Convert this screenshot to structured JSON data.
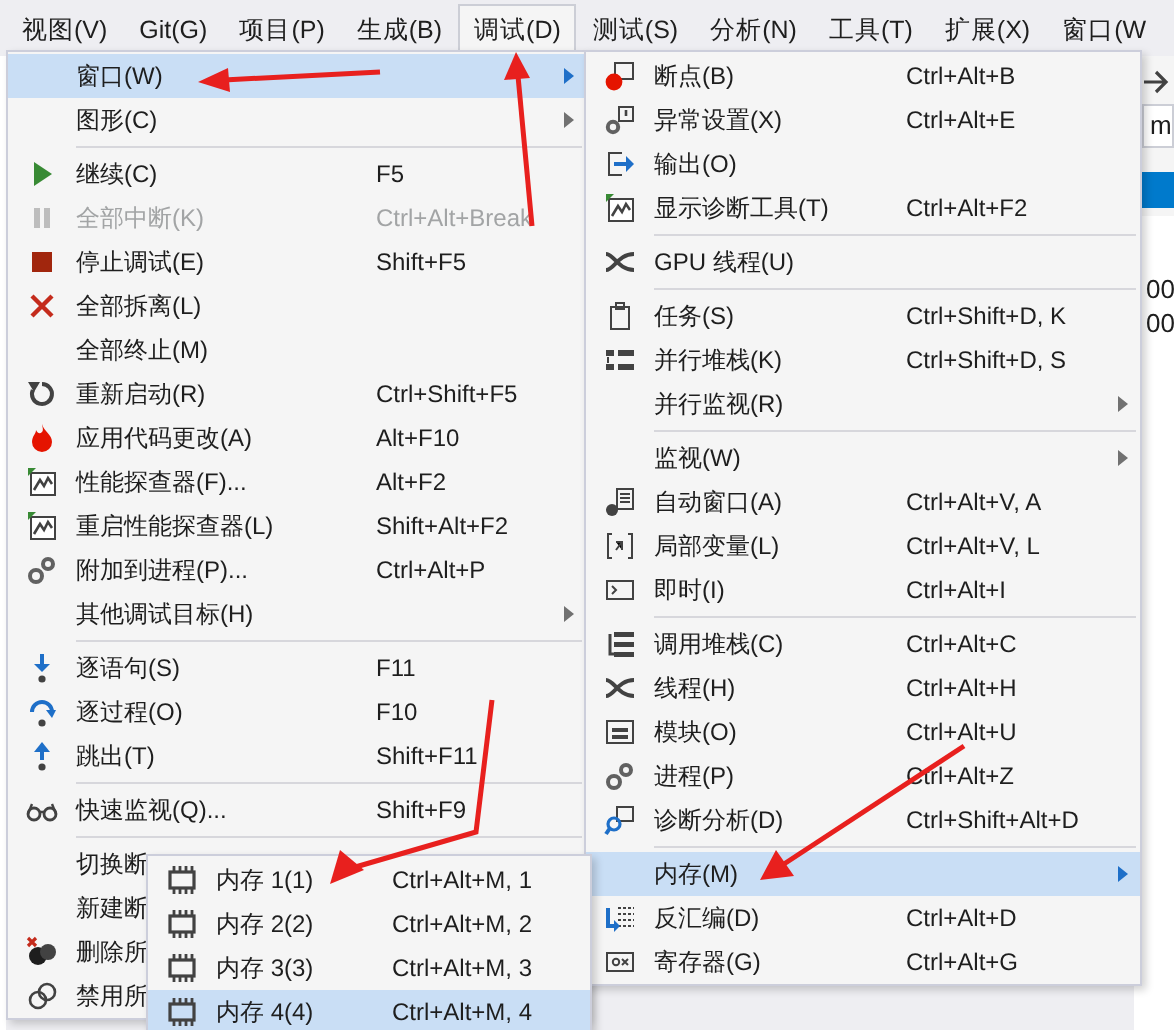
{
  "menu_bar": [
    {
      "label": "视图(V)",
      "selected": false
    },
    {
      "label": "Git(G)",
      "selected": false
    },
    {
      "label": "项目(P)",
      "selected": false
    },
    {
      "label": "生成(B)",
      "selected": false
    },
    {
      "label": "调试(D)",
      "selected": true
    },
    {
      "label": "测试(S)",
      "selected": false
    },
    {
      "label": "分析(N)",
      "selected": false
    },
    {
      "label": "工具(T)",
      "selected": false
    },
    {
      "label": "扩展(X)",
      "selected": false
    },
    {
      "label": "窗口(W",
      "selected": false
    }
  ],
  "background": {
    "field_value": "m",
    "lines": [
      "00",
      "00"
    ]
  },
  "debug_menu": {
    "items": [
      {
        "kind": "item",
        "label": "窗口(W)",
        "submenu": true,
        "disabled": false,
        "selected": true
      },
      {
        "kind": "item",
        "label": "图形(C)",
        "submenu": true,
        "disabled": false,
        "selected": false
      },
      {
        "kind": "separator"
      },
      {
        "kind": "item",
        "label": "继续(C)",
        "shortcut": "F5",
        "submenu": false,
        "disabled": false,
        "selected": false
      },
      {
        "kind": "item",
        "label": "全部中断(K)",
        "shortcut": "Ctrl+Alt+Break",
        "submenu": false,
        "disabled": true,
        "selected": false
      },
      {
        "kind": "item",
        "label": "停止调试(E)",
        "shortcut": "Shift+F5",
        "submenu": false,
        "disabled": false,
        "selected": false
      },
      {
        "kind": "item",
        "label": "全部拆离(L)",
        "submenu": false,
        "disabled": false,
        "selected": false
      },
      {
        "kind": "item",
        "label": "全部终止(M)",
        "submenu": false,
        "disabled": false,
        "selected": false
      },
      {
        "kind": "item",
        "label": "重新启动(R)",
        "shortcut": "Ctrl+Shift+F5",
        "submenu": false,
        "disabled": false,
        "selected": false
      },
      {
        "kind": "item",
        "label": "应用代码更改(A)",
        "shortcut": "Alt+F10",
        "submenu": false,
        "disabled": false,
        "selected": false
      },
      {
        "kind": "item",
        "label": "性能探查器(F)...",
        "shortcut": "Alt+F2",
        "submenu": false,
        "disabled": false,
        "selected": false
      },
      {
        "kind": "item",
        "label": "重启性能探查器(L)",
        "shortcut": "Shift+Alt+F2",
        "submenu": false,
        "disabled": false,
        "selected": false
      },
      {
        "kind": "item",
        "label": "附加到进程(P)...",
        "shortcut": "Ctrl+Alt+P",
        "submenu": false,
        "disabled": false,
        "selected": false
      },
      {
        "kind": "item",
        "label": "其他调试目标(H)",
        "submenu": true,
        "disabled": false,
        "selected": false
      },
      {
        "kind": "separator"
      },
      {
        "kind": "item",
        "label": "逐语句(S)",
        "shortcut": "F11",
        "submenu": false,
        "disabled": false,
        "selected": false
      },
      {
        "kind": "item",
        "label": "逐过程(O)",
        "shortcut": "F10",
        "submenu": false,
        "disabled": false,
        "selected": false
      },
      {
        "kind": "item",
        "label": "跳出(T)",
        "shortcut": "Shift+F11",
        "submenu": false,
        "disabled": false,
        "selected": false
      },
      {
        "kind": "separator"
      },
      {
        "kind": "item",
        "label": "快速监视(Q)...",
        "shortcut": "Shift+F9",
        "submenu": false,
        "disabled": false,
        "selected": false
      },
      {
        "kind": "separator"
      },
      {
        "kind": "item",
        "label": "切换断",
        "disabled": false,
        "selected": false
      },
      {
        "kind": "item",
        "label": "新建断",
        "disabled": false,
        "selected": false
      },
      {
        "kind": "item",
        "label": "删除所",
        "disabled": false,
        "selected": false
      },
      {
        "kind": "item",
        "label": "禁用所",
        "disabled": false,
        "selected": false
      }
    ]
  },
  "window_submenu": {
    "items": [
      {
        "kind": "item",
        "label": "断点(B)",
        "shortcut": "Ctrl+Alt+B",
        "submenu": false,
        "selected": false
      },
      {
        "kind": "item",
        "label": "异常设置(X)",
        "shortcut": "Ctrl+Alt+E",
        "submenu": false,
        "selected": false
      },
      {
        "kind": "item",
        "label": "输出(O)",
        "submenu": false,
        "selected": false
      },
      {
        "kind": "item",
        "label": "显示诊断工具(T)",
        "shortcut": "Ctrl+Alt+F2",
        "submenu": false,
        "selected": false
      },
      {
        "kind": "separator"
      },
      {
        "kind": "item",
        "label": "GPU 线程(U)",
        "submenu": false,
        "selected": false
      },
      {
        "kind": "separator"
      },
      {
        "kind": "item",
        "label": "任务(S)",
        "shortcut": "Ctrl+Shift+D, K",
        "submenu": false,
        "selected": false
      },
      {
        "kind": "item",
        "label": "并行堆栈(K)",
        "shortcut": "Ctrl+Shift+D, S",
        "submenu": false,
        "selected": false
      },
      {
        "kind": "item",
        "label": "并行监视(R)",
        "submenu": true,
        "selected": false
      },
      {
        "kind": "separator"
      },
      {
        "kind": "item",
        "label": "监视(W)",
        "submenu": true,
        "selected": false
      },
      {
        "kind": "item",
        "label": "自动窗口(A)",
        "shortcut": "Ctrl+Alt+V, A",
        "submenu": false,
        "selected": false
      },
      {
        "kind": "item",
        "label": "局部变量(L)",
        "shortcut": "Ctrl+Alt+V, L",
        "submenu": false,
        "selected": false
      },
      {
        "kind": "item",
        "label": "即时(I)",
        "shortcut": "Ctrl+Alt+I",
        "submenu": false,
        "selected": false
      },
      {
        "kind": "separator"
      },
      {
        "kind": "item",
        "label": "调用堆栈(C)",
        "shortcut": "Ctrl+Alt+C",
        "submenu": false,
        "selected": false
      },
      {
        "kind": "item",
        "label": "线程(H)",
        "shortcut": "Ctrl+Alt+H",
        "submenu": false,
        "selected": false
      },
      {
        "kind": "item",
        "label": "模块(O)",
        "shortcut": "Ctrl+Alt+U",
        "submenu": false,
        "selected": false
      },
      {
        "kind": "item",
        "label": "进程(P)",
        "shortcut": "Ctrl+Alt+Z",
        "submenu": false,
        "selected": false
      },
      {
        "kind": "item",
        "label": "诊断分析(D)",
        "shortcut": "Ctrl+Shift+Alt+D",
        "submenu": false,
        "selected": false
      },
      {
        "kind": "separator"
      },
      {
        "kind": "item",
        "label": "内存(M)",
        "submenu": true,
        "selected": true
      },
      {
        "kind": "item",
        "label": "反汇编(D)",
        "shortcut": "Ctrl+Alt+D",
        "submenu": false,
        "selected": false
      },
      {
        "kind": "item",
        "label": "寄存器(G)",
        "shortcut": "Ctrl+Alt+G",
        "submenu": false,
        "selected": false
      }
    ]
  },
  "memory_submenu": {
    "items": [
      {
        "kind": "item",
        "label": "内存 1(1)",
        "shortcut": "Ctrl+Alt+M, 1",
        "selected": false
      },
      {
        "kind": "item",
        "label": "内存 2(2)",
        "shortcut": "Ctrl+Alt+M, 2",
        "selected": false
      },
      {
        "kind": "item",
        "label": "内存 3(3)",
        "shortcut": "Ctrl+Alt+M, 3",
        "selected": false
      },
      {
        "kind": "item",
        "label": "内存 4(4)",
        "shortcut": "Ctrl+Alt+M, 4",
        "selected": true
      }
    ]
  }
}
